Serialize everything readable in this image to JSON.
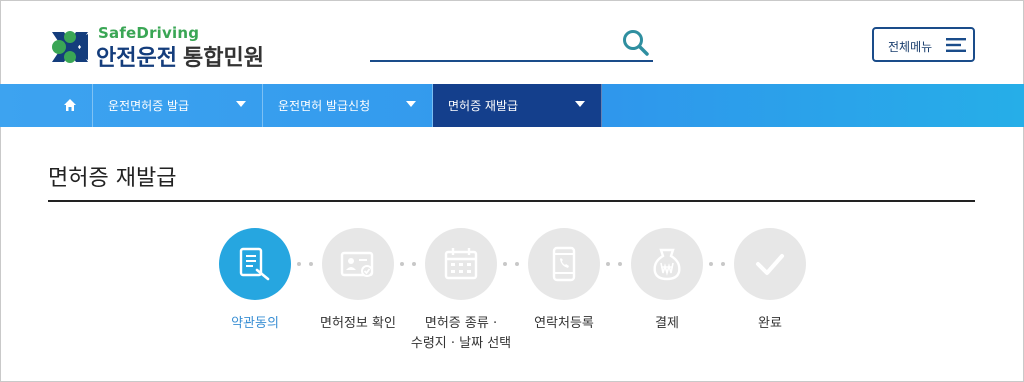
{
  "brand": {
    "sub": "SafeDriving",
    "main": "안전운전",
    "suffix": "통합민원",
    "colors": {
      "green": "#3aa655",
      "navy": "#143d7c"
    }
  },
  "search": {
    "value": "",
    "placeholder": "",
    "icon": "search-icon"
  },
  "all_menu": {
    "label": "전체메뉴",
    "icon": "hamburger-icon"
  },
  "nav": {
    "home_icon": "home-icon",
    "items": [
      {
        "label": "운전면허증 발급",
        "active": false
      },
      {
        "label": "운전면허 발급신청",
        "active": false
      },
      {
        "label": "면허증 재발급",
        "active": true
      }
    ],
    "colors": {
      "bar": "#3da3f0",
      "active": "#143f8c"
    }
  },
  "page": {
    "title": "면허증 재발급"
  },
  "steps": [
    {
      "label": "약관동의",
      "icon": "document-icon",
      "active": true
    },
    {
      "label": "면허정보 확인",
      "icon": "id-card-icon",
      "active": false
    },
    {
      "label": "면허증 종류 ·\n수령지 · 날짜 선택",
      "icon": "calendar-icon",
      "active": false
    },
    {
      "label": "연락처등록",
      "icon": "phone-icon",
      "active": false
    },
    {
      "label": "결제",
      "icon": "payment-icon",
      "active": false
    },
    {
      "label": "완료",
      "icon": "check-icon",
      "active": false
    }
  ],
  "step_colors": {
    "active": "#26a6e0",
    "inactive": "#e7e7e7"
  }
}
